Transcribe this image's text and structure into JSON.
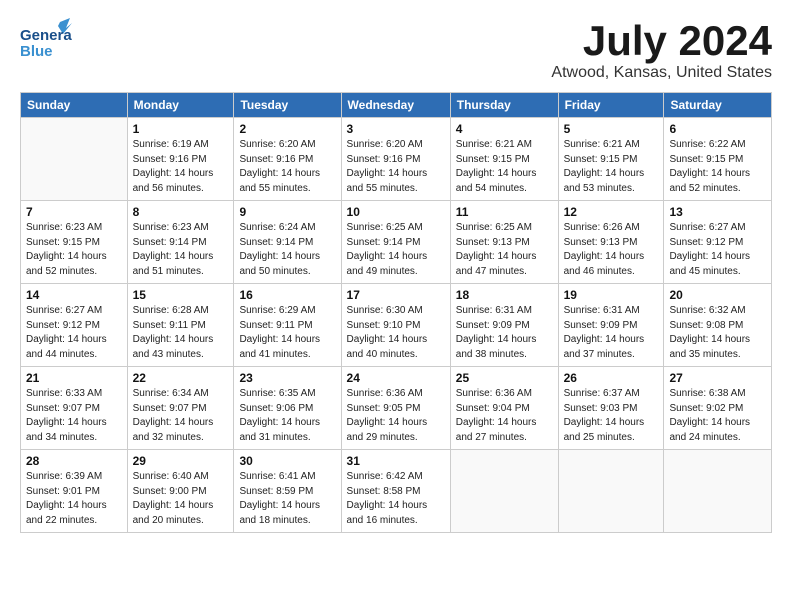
{
  "logo": {
    "general": "General",
    "blue": "Blue"
  },
  "title": "July 2024",
  "subtitle": "Atwood, Kansas, United States",
  "days_header": [
    "Sunday",
    "Monday",
    "Tuesday",
    "Wednesday",
    "Thursday",
    "Friday",
    "Saturday"
  ],
  "weeks": [
    [
      {
        "num": "",
        "content": ""
      },
      {
        "num": "1",
        "content": "Sunrise: 6:19 AM\nSunset: 9:16 PM\nDaylight: 14 hours\nand 56 minutes."
      },
      {
        "num": "2",
        "content": "Sunrise: 6:20 AM\nSunset: 9:16 PM\nDaylight: 14 hours\nand 55 minutes."
      },
      {
        "num": "3",
        "content": "Sunrise: 6:20 AM\nSunset: 9:16 PM\nDaylight: 14 hours\nand 55 minutes."
      },
      {
        "num": "4",
        "content": "Sunrise: 6:21 AM\nSunset: 9:15 PM\nDaylight: 14 hours\nand 54 minutes."
      },
      {
        "num": "5",
        "content": "Sunrise: 6:21 AM\nSunset: 9:15 PM\nDaylight: 14 hours\nand 53 minutes."
      },
      {
        "num": "6",
        "content": "Sunrise: 6:22 AM\nSunset: 9:15 PM\nDaylight: 14 hours\nand 52 minutes."
      }
    ],
    [
      {
        "num": "7",
        "content": "Sunrise: 6:23 AM\nSunset: 9:15 PM\nDaylight: 14 hours\nand 52 minutes."
      },
      {
        "num": "8",
        "content": "Sunrise: 6:23 AM\nSunset: 9:14 PM\nDaylight: 14 hours\nand 51 minutes."
      },
      {
        "num": "9",
        "content": "Sunrise: 6:24 AM\nSunset: 9:14 PM\nDaylight: 14 hours\nand 50 minutes."
      },
      {
        "num": "10",
        "content": "Sunrise: 6:25 AM\nSunset: 9:14 PM\nDaylight: 14 hours\nand 49 minutes."
      },
      {
        "num": "11",
        "content": "Sunrise: 6:25 AM\nSunset: 9:13 PM\nDaylight: 14 hours\nand 47 minutes."
      },
      {
        "num": "12",
        "content": "Sunrise: 6:26 AM\nSunset: 9:13 PM\nDaylight: 14 hours\nand 46 minutes."
      },
      {
        "num": "13",
        "content": "Sunrise: 6:27 AM\nSunset: 9:12 PM\nDaylight: 14 hours\nand 45 minutes."
      }
    ],
    [
      {
        "num": "14",
        "content": "Sunrise: 6:27 AM\nSunset: 9:12 PM\nDaylight: 14 hours\nand 44 minutes."
      },
      {
        "num": "15",
        "content": "Sunrise: 6:28 AM\nSunset: 9:11 PM\nDaylight: 14 hours\nand 43 minutes."
      },
      {
        "num": "16",
        "content": "Sunrise: 6:29 AM\nSunset: 9:11 PM\nDaylight: 14 hours\nand 41 minutes."
      },
      {
        "num": "17",
        "content": "Sunrise: 6:30 AM\nSunset: 9:10 PM\nDaylight: 14 hours\nand 40 minutes."
      },
      {
        "num": "18",
        "content": "Sunrise: 6:31 AM\nSunset: 9:09 PM\nDaylight: 14 hours\nand 38 minutes."
      },
      {
        "num": "19",
        "content": "Sunrise: 6:31 AM\nSunset: 9:09 PM\nDaylight: 14 hours\nand 37 minutes."
      },
      {
        "num": "20",
        "content": "Sunrise: 6:32 AM\nSunset: 9:08 PM\nDaylight: 14 hours\nand 35 minutes."
      }
    ],
    [
      {
        "num": "21",
        "content": "Sunrise: 6:33 AM\nSunset: 9:07 PM\nDaylight: 14 hours\nand 34 minutes."
      },
      {
        "num": "22",
        "content": "Sunrise: 6:34 AM\nSunset: 9:07 PM\nDaylight: 14 hours\nand 32 minutes."
      },
      {
        "num": "23",
        "content": "Sunrise: 6:35 AM\nSunset: 9:06 PM\nDaylight: 14 hours\nand 31 minutes."
      },
      {
        "num": "24",
        "content": "Sunrise: 6:36 AM\nSunset: 9:05 PM\nDaylight: 14 hours\nand 29 minutes."
      },
      {
        "num": "25",
        "content": "Sunrise: 6:36 AM\nSunset: 9:04 PM\nDaylight: 14 hours\nand 27 minutes."
      },
      {
        "num": "26",
        "content": "Sunrise: 6:37 AM\nSunset: 9:03 PM\nDaylight: 14 hours\nand 25 minutes."
      },
      {
        "num": "27",
        "content": "Sunrise: 6:38 AM\nSunset: 9:02 PM\nDaylight: 14 hours\nand 24 minutes."
      }
    ],
    [
      {
        "num": "28",
        "content": "Sunrise: 6:39 AM\nSunset: 9:01 PM\nDaylight: 14 hours\nand 22 minutes."
      },
      {
        "num": "29",
        "content": "Sunrise: 6:40 AM\nSunset: 9:00 PM\nDaylight: 14 hours\nand 20 minutes."
      },
      {
        "num": "30",
        "content": "Sunrise: 6:41 AM\nSunset: 8:59 PM\nDaylight: 14 hours\nand 18 minutes."
      },
      {
        "num": "31",
        "content": "Sunrise: 6:42 AM\nSunset: 8:58 PM\nDaylight: 14 hours\nand 16 minutes."
      },
      {
        "num": "",
        "content": ""
      },
      {
        "num": "",
        "content": ""
      },
      {
        "num": "",
        "content": ""
      }
    ]
  ]
}
